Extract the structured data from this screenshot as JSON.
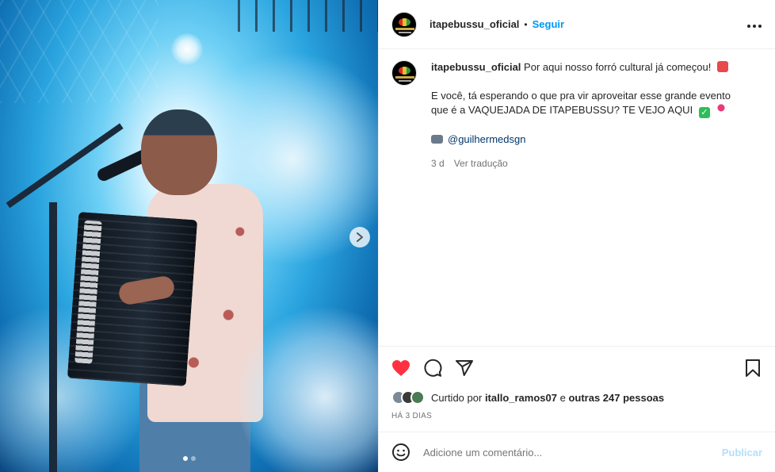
{
  "post": {
    "username": "itapebussu_oficial",
    "separator": "•",
    "follow_label": "Seguir",
    "more_icon": "more-options-icon",
    "caption": {
      "line1": "Por aqui nosso forró cultural já começou!",
      "line2": "E você, tá esperando o que pra vir aproveitar esse grande evento que é a VAQUEJADA DE ITAPEBUSSU? TE VEJO AQUI",
      "credit": "@guilhermedsgn",
      "age": "3 d",
      "translate_label": "Ver tradução"
    },
    "actions": {
      "like_icon": "heart-filled-icon",
      "like_color": "#ff3040",
      "comment_icon": "comment-icon",
      "share_icon": "share-icon",
      "save_icon": "bookmark-icon"
    },
    "likes": {
      "prefix": "Curtido por",
      "first_user": "itallo_ramos07",
      "connector": "e",
      "others": "outras 247 pessoas"
    },
    "timestamp": "HÁ 3 DIAS",
    "comment": {
      "placeholder": "Adicione um comentário...",
      "post_label": "Publicar"
    },
    "carousel": {
      "next_icon": "chevron-right-icon",
      "dots": 2,
      "active_dot": 1
    }
  }
}
